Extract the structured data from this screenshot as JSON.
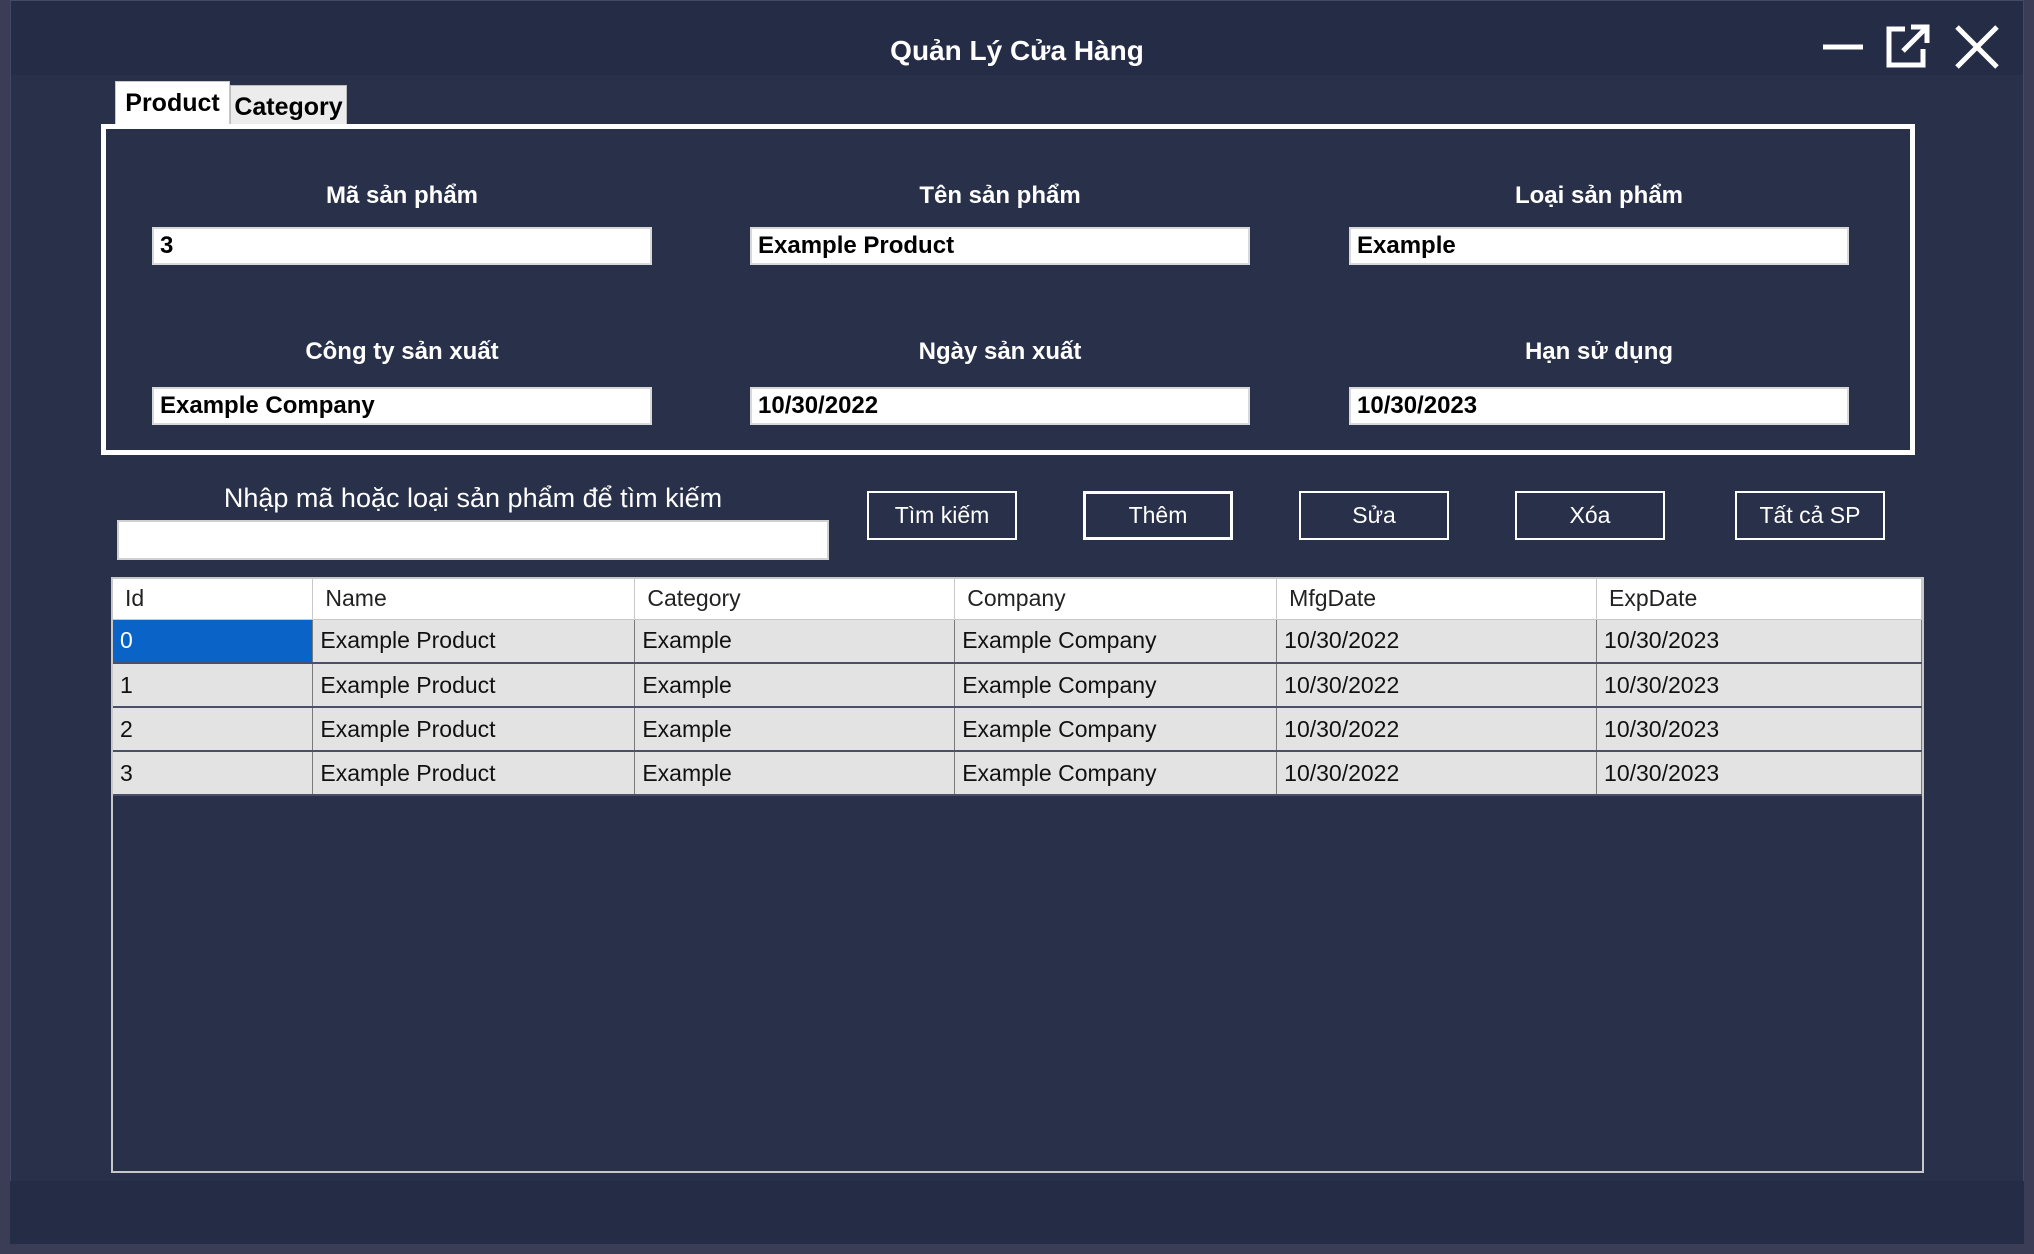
{
  "window": {
    "title": "Quản Lý Cửa Hàng"
  },
  "tabs": [
    {
      "label": "Product",
      "active": true
    },
    {
      "label": "Category",
      "active": false
    }
  ],
  "form": {
    "product_id": {
      "label": "Mã sản phẩm",
      "value": "3"
    },
    "product_name": {
      "label": "Tên sản phẩm",
      "value": "Example Product"
    },
    "product_category": {
      "label": "Loại sản phẩm",
      "value": "Example"
    },
    "company": {
      "label": "Công ty sản xuất",
      "value": "Example Company"
    },
    "mfg_date": {
      "label": "Ngày sản xuất",
      "value": "10/30/2022"
    },
    "exp_date": {
      "label": "Hạn sử dụng",
      "value": "10/30/2023"
    }
  },
  "search": {
    "label": "Nhập mã hoặc loại sản phẩm để tìm kiếm",
    "value": ""
  },
  "buttons": {
    "search": "Tìm kiếm",
    "add": "Thêm",
    "edit": "Sửa",
    "delete": "Xóa",
    "all": "Tất cả SP"
  },
  "table": {
    "columns": [
      "Id",
      "Name",
      "Category",
      "Company",
      "MfgDate",
      "ExpDate"
    ],
    "rows": [
      [
        "0",
        "Example Product",
        "Example",
        "Example Company",
        "10/30/2022",
        "10/30/2023"
      ],
      [
        "1",
        "Example Product",
        "Example",
        "Example Company",
        "10/30/2022",
        "10/30/2023"
      ],
      [
        "2",
        "Example Product",
        "Example",
        "Example Company",
        "10/30/2022",
        "10/30/2023"
      ],
      [
        "3",
        "Example Product",
        "Example",
        "Example Company",
        "10/30/2022",
        "10/30/2023"
      ]
    ]
  },
  "icons": {
    "minimize": "minimize-icon",
    "popout": "external-window-icon",
    "close": "close-icon"
  },
  "colors": {
    "background": "#293049",
    "titlebar": "#252c45",
    "selection": "#0a64c8"
  }
}
